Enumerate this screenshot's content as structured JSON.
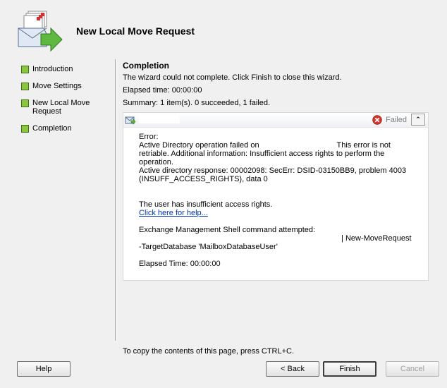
{
  "header": {
    "title": "New Local Move Request"
  },
  "nav": {
    "items": [
      {
        "label": "Introduction"
      },
      {
        "label": "Move Settings"
      },
      {
        "label": "New Local Move Request"
      },
      {
        "label": "Completion"
      }
    ],
    "bullet_color": "#8cc63f"
  },
  "content": {
    "title": "Completion",
    "message": "The wizard could not complete. Click Finish to close this wizard.",
    "elapsed": "Elapsed time: 00:00:00",
    "summary": "Summary: 1 item(s). 0 succeeded, 1 failed."
  },
  "result": {
    "status": "Failed",
    "status_color": "#c0392b",
    "collapse_glyph": "⌃",
    "error_label": "Error:",
    "error_line1_a": "Active Directory operation failed on",
    "error_line1_b": "This error is not retriable. Additional information: Insufficient access rights to perform the operation.",
    "error_line2": "Active directory response: 00002098: SecErr: DSID-03150BB9, problem 4003 (INSUFF_ACCESS_RIGHTS), data 0",
    "access_note": "The user has insufficient access rights.",
    "help_link": "Click here for help...",
    "shell_label": "Exchange Management Shell command attempted:",
    "shell_cmd_end": "| New-MoveRequest",
    "shell_cmd_line2": "-TargetDatabase 'MailboxDatabaseUser'",
    "elapsed": "Elapsed Time: 00:00:00"
  },
  "footer": {
    "hint": "To copy the contents of this page, press CTRL+C.",
    "help": "Help",
    "back": "< Back",
    "finish": "Finish",
    "cancel": "Cancel"
  }
}
